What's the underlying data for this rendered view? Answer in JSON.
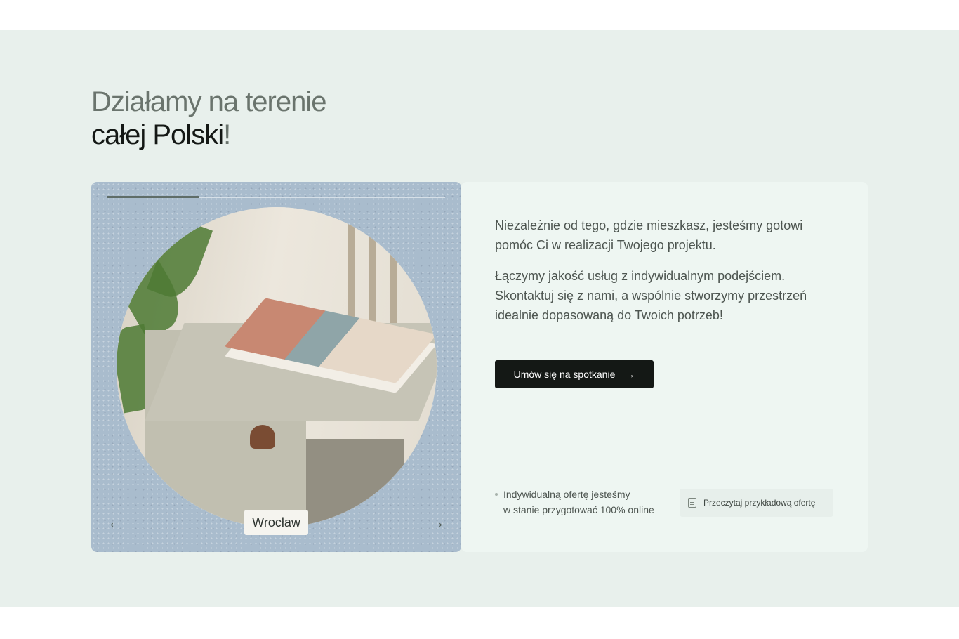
{
  "heading": {
    "line1": "Działamy na terenie",
    "line2": "całej Polski",
    "exclamation": "!"
  },
  "slider": {
    "city": "Wrocław",
    "progress": 0.27,
    "prev_icon": "arrow-left-icon",
    "next_icon": "arrow-right-icon",
    "prev_glyph": "←",
    "next_glyph": "→"
  },
  "card": {
    "paragraph1": "Niezależnie od tego, gdzie mieszkasz, jesteśmy gotowi pomóc Ci w realizacji Twojego projektu.",
    "paragraph2": "Łączymy jakość usług z indywidualnym podejściem. Skontaktuj się z nami, a wspólnie stworzymy przestrzeń idealnie dopasowaną do Twoich potrzeb!",
    "cta_label": "Umów się na spotkanie",
    "cta_arrow": "→",
    "note_line1": "Indywidualną ofertę jesteśmy",
    "note_line2": "w stanie przygotować 100% online",
    "offer_button_label": "Przeczytaj przykładową ofertę",
    "offer_icon": "document-icon"
  },
  "colors": {
    "section_bg": "#e8f0ec",
    "card_bg": "#eef6f2",
    "slider_bg": "#a9bccd",
    "cta_bg": "#141815"
  }
}
